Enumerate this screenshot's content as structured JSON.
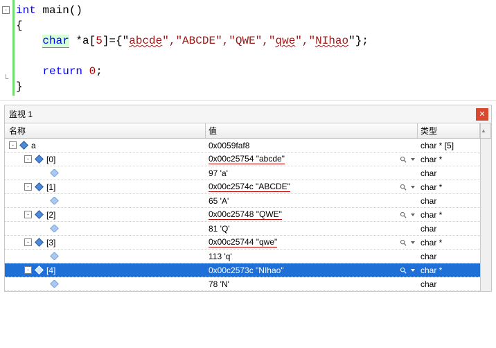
{
  "code": {
    "kw_int": "int",
    "fn": " main()",
    "brace_open": "{",
    "kw_char": "char",
    "decl_mid": " *a[",
    "arr_size": "5",
    "decl_eq": "]={\"",
    "s1": "abcde",
    "sep1": "\",\"ABCDE\",\"QWE\",\"",
    "s4": "qwe",
    "sep2": "\",\"",
    "s5": "NIhao",
    "decl_end": "\"};",
    "kw_return": "return",
    "ret_sp": " ",
    "ret_num": "0",
    "ret_semi": ";",
    "brace_close": "}"
  },
  "panel": {
    "title": "监视 1",
    "close": "✕",
    "headers": {
      "name": "名称",
      "value": "值",
      "type": "类型"
    }
  },
  "rows": [
    {
      "depth": 0,
      "expand": "-",
      "icon": "d",
      "name": "a",
      "value": "0x0059faf8",
      "ul": false,
      "mag": false,
      "type": "char * [5]",
      "sel": false
    },
    {
      "depth": 1,
      "expand": "-",
      "icon": "d",
      "name": "[0]",
      "value": "0x00c25754 \"abcde\"",
      "ul": true,
      "mag": true,
      "type": "char *",
      "sel": false
    },
    {
      "depth": 2,
      "expand": "",
      "icon": "dl",
      "name": "",
      "value": "97 'a'",
      "ul": false,
      "mag": false,
      "type": "char",
      "sel": false
    },
    {
      "depth": 1,
      "expand": "-",
      "icon": "d",
      "name": "[1]",
      "value": "0x00c2574c \"ABCDE\"",
      "ul": true,
      "mag": true,
      "type": "char *",
      "sel": false
    },
    {
      "depth": 2,
      "expand": "",
      "icon": "dl",
      "name": "",
      "value": "65 'A'",
      "ul": false,
      "mag": false,
      "type": "char",
      "sel": false
    },
    {
      "depth": 1,
      "expand": "-",
      "icon": "d",
      "name": "[2]",
      "value": "0x00c25748 \"QWE\"",
      "ul": true,
      "mag": true,
      "type": "char *",
      "sel": false
    },
    {
      "depth": 2,
      "expand": "",
      "icon": "dl",
      "name": "",
      "value": "81 'Q'",
      "ul": false,
      "mag": false,
      "type": "char",
      "sel": false
    },
    {
      "depth": 1,
      "expand": "-",
      "icon": "d",
      "name": "[3]",
      "value": "0x00c25744 \"qwe\"",
      "ul": true,
      "mag": true,
      "type": "char *",
      "sel": false
    },
    {
      "depth": 2,
      "expand": "",
      "icon": "dl",
      "name": "",
      "value": "113 'q'",
      "ul": false,
      "mag": false,
      "type": "char",
      "sel": false
    },
    {
      "depth": 1,
      "expand": "-",
      "icon": "d",
      "name": "[4]",
      "value": "0x00c2573c \"NIhao\"",
      "ul": false,
      "mag": true,
      "type": "char *",
      "sel": true
    },
    {
      "depth": 2,
      "expand": "",
      "icon": "dl",
      "name": "",
      "value": "78 'N'",
      "ul": false,
      "mag": false,
      "type": "char",
      "sel": false
    }
  ]
}
